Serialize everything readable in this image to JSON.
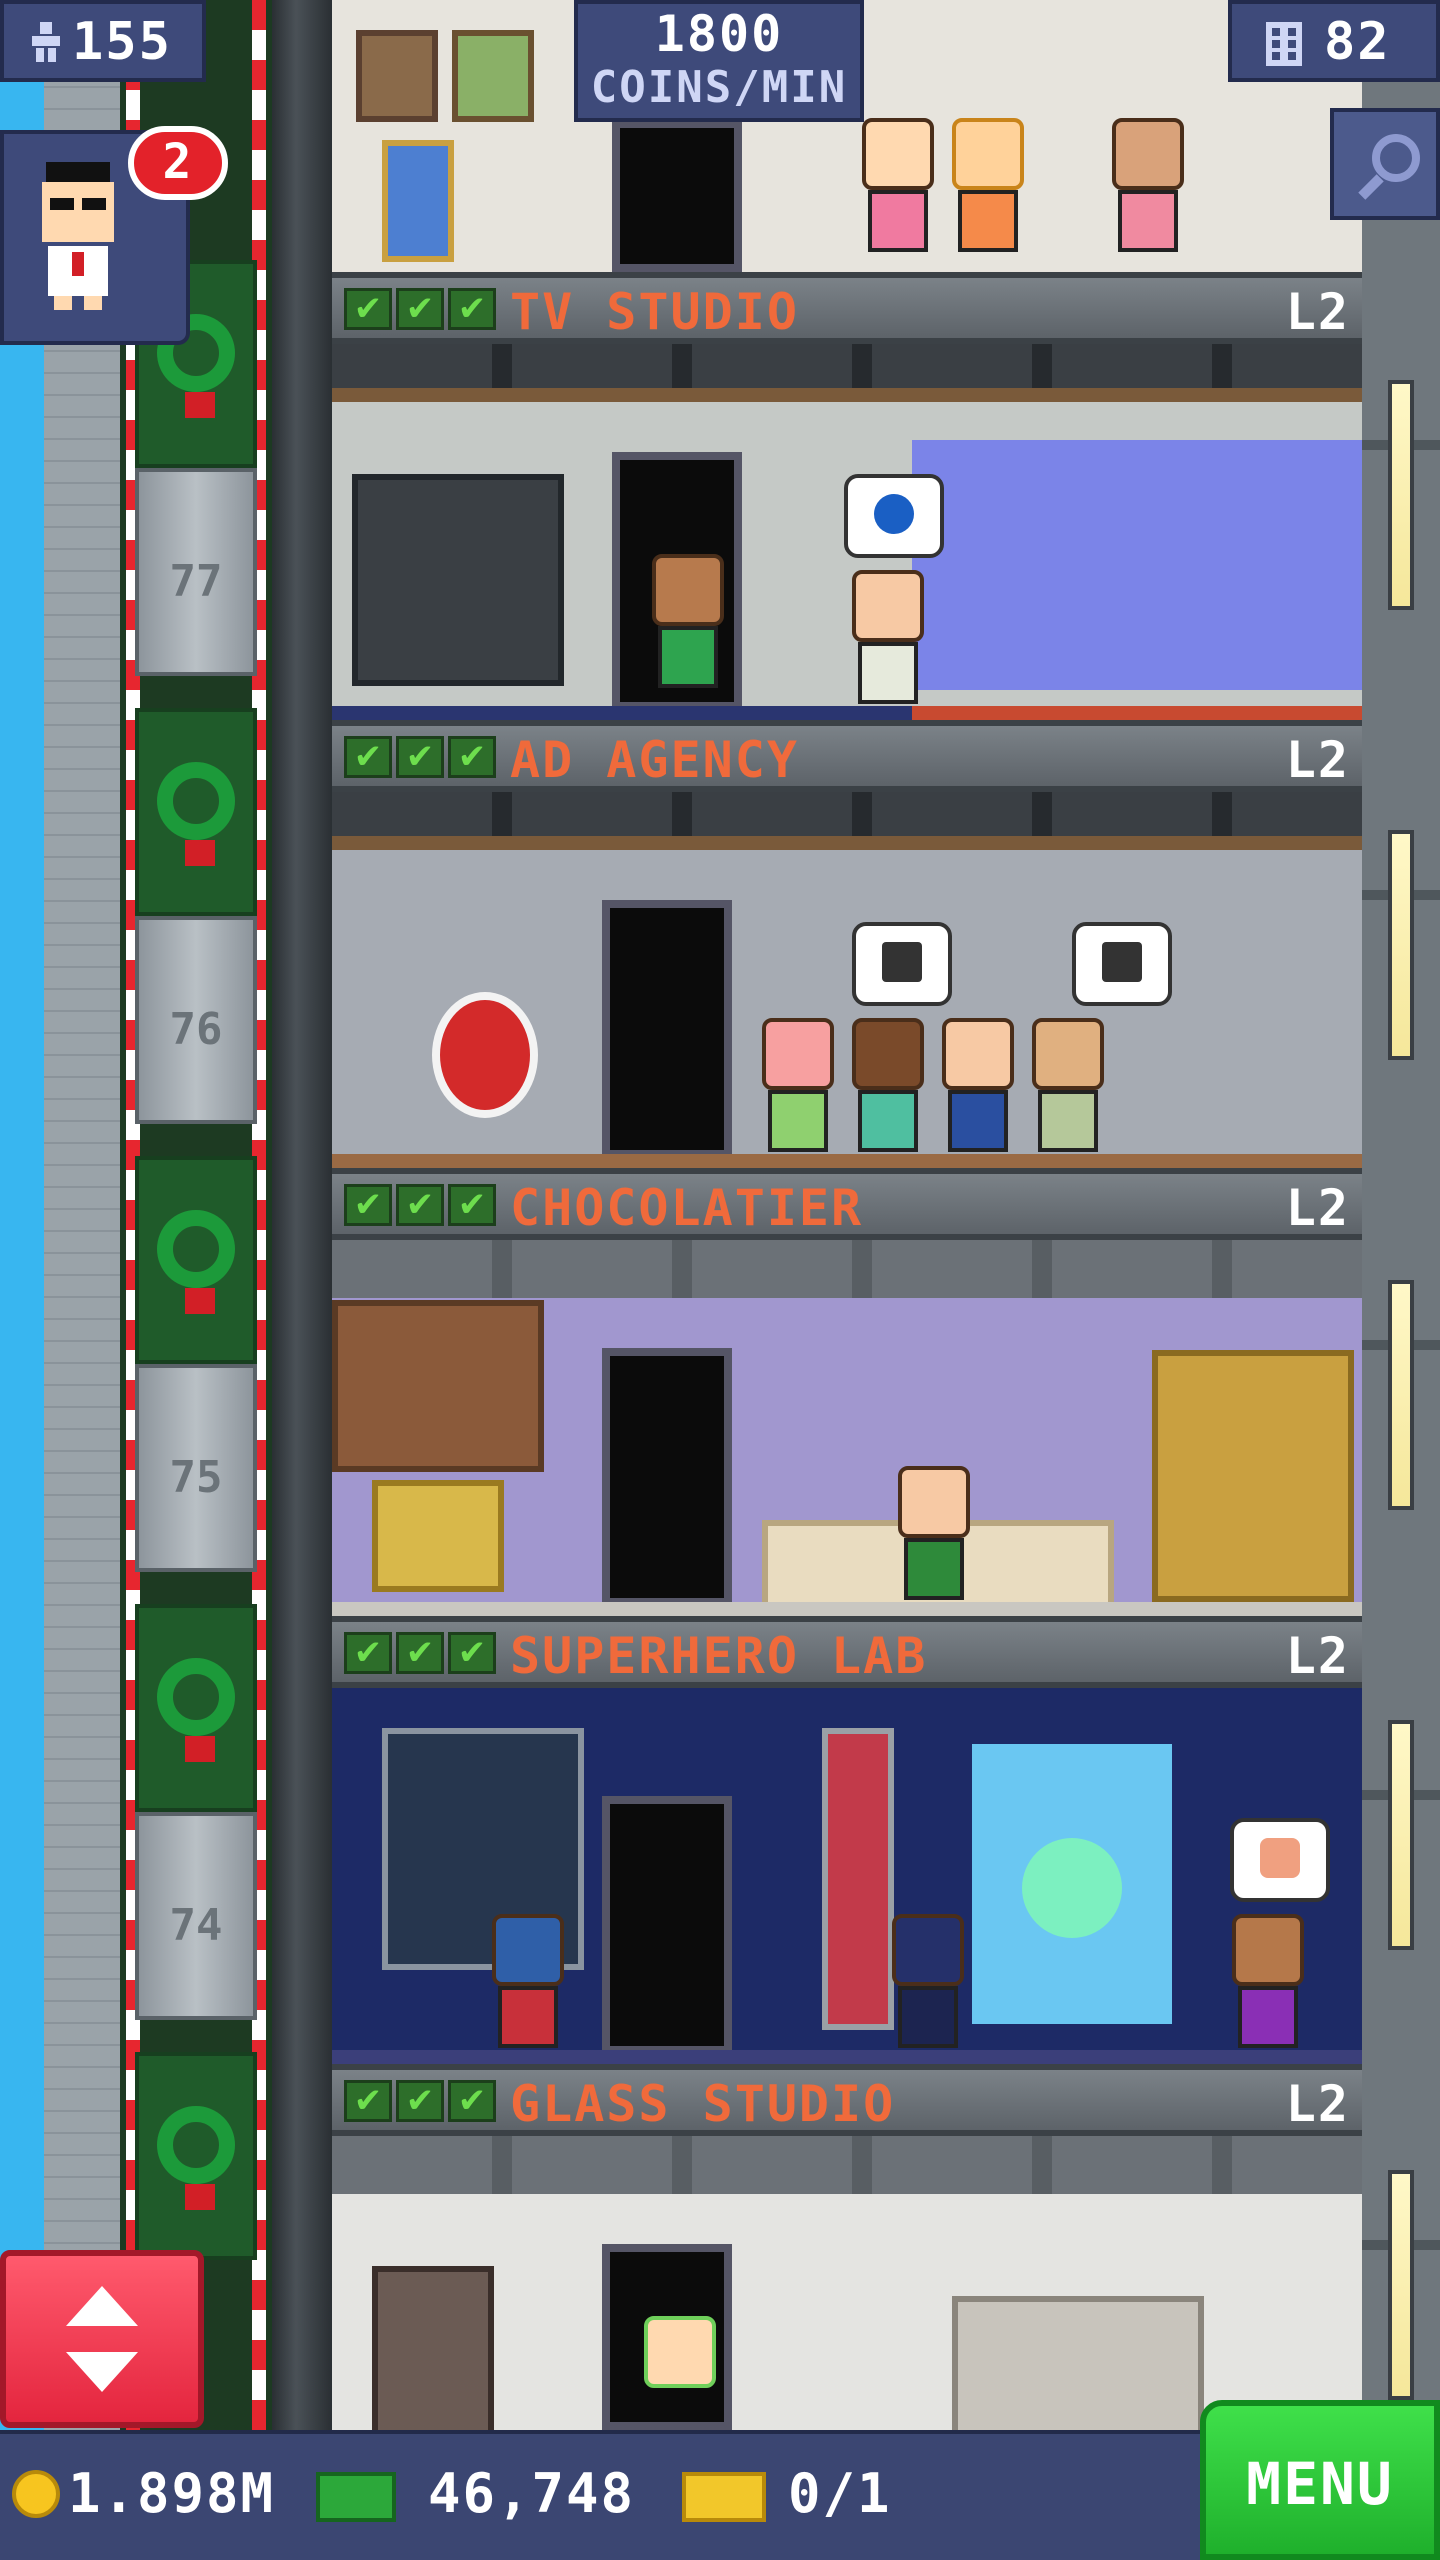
{
  "hud": {
    "population": "155",
    "coins_rate_value": "1800",
    "coins_rate_unit": "COINS/MIN",
    "floors_count": "82",
    "notification_count": "2"
  },
  "elevator": {
    "floor_numbers": [
      "77",
      "76",
      "75",
      "74"
    ]
  },
  "floors": [
    {
      "name": "TV STUDIO",
      "level": "L2",
      "check_count": 3
    },
    {
      "name": "AD AGENCY",
      "level": "L2",
      "check_count": 3
    },
    {
      "name": "CHOCOLATIER",
      "level": "L2",
      "check_count": 3
    },
    {
      "name": "SUPERHERO LAB",
      "level": "L2",
      "check_count": 3
    },
    {
      "name": "GLASS STUDIO",
      "level": "L2",
      "check_count": 3
    }
  ],
  "bottom_bar": {
    "coins": "1.898M",
    "bux": "46,748",
    "tickets": "0/1",
    "menu_label": "MENU"
  },
  "icons": {
    "check": "✔",
    "population": "person-icon",
    "floors": "building-icon",
    "search": "magnifier-icon",
    "coins": "coin-icon",
    "bux": "bux-icon",
    "tickets": "ticket-icon"
  },
  "colors": {
    "floor_name": "#f06a3b",
    "menu_green": "#2fcf3a",
    "elevator_red": "#e4253e",
    "hud_blue": "#3e4a7a"
  }
}
